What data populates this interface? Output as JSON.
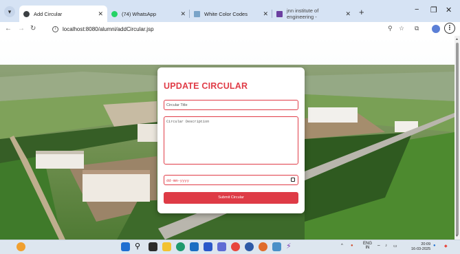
{
  "browser": {
    "tabs": [
      {
        "title": "Add Circular",
        "active": true,
        "icon": "globe-icon",
        "color": "#3c4043"
      },
      {
        "title": "(74) WhatsApp",
        "active": false,
        "icon": "whatsapp-icon",
        "color": "#25d366"
      },
      {
        "title": "White Color Codes",
        "active": false,
        "icon": "grid-icon",
        "color": "#7aa4c8"
      },
      {
        "title": "jnn institute of engineering - ",
        "active": false,
        "icon": "youtube-like-icon",
        "color": "#6b3fa0"
      }
    ],
    "new_tab": "+",
    "window_controls": {
      "minimize": "−",
      "maximize": "❐",
      "close": "✕"
    },
    "url": "localhost:8080/alumni/addCircular.jsp"
  },
  "form": {
    "heading": "UPDATE CIRCULAR",
    "title_placeholder": "Circular Title",
    "description_placeholder": "Circular Description",
    "date_placeholder": "dd-mm-yyyy",
    "submit_label": "Submit Circular"
  },
  "taskbar": {
    "lang_top": "ENG",
    "lang_bottom": "IN",
    "time": "20:09",
    "date": "16-03-2025"
  },
  "colors": {
    "accent": "#e03c47",
    "button": "#de3b46"
  }
}
